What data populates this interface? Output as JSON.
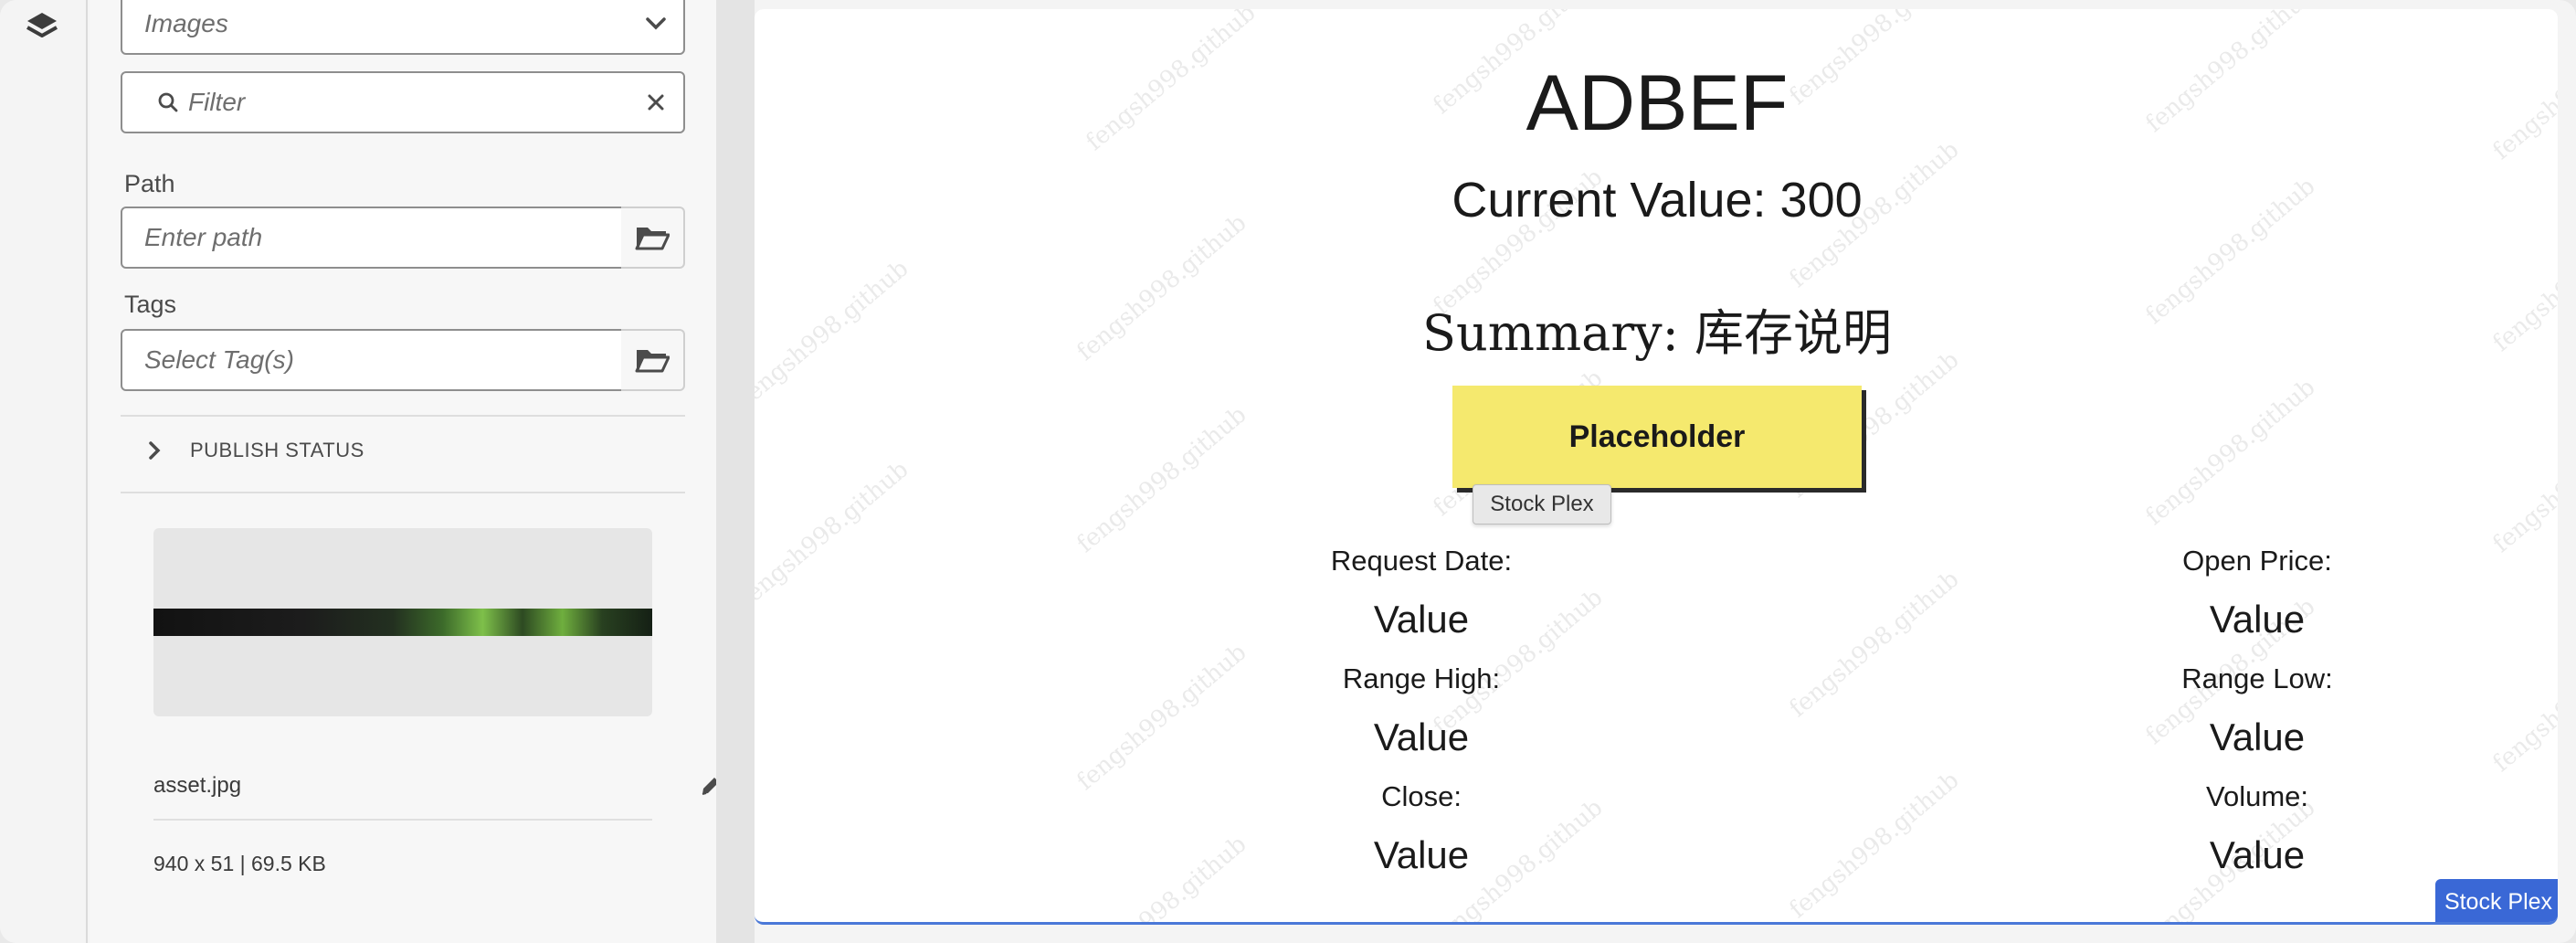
{
  "sidebar": {
    "asset_type": "Images",
    "filter_placeholder": "Filter",
    "path_label": "Path",
    "path_placeholder": "Enter path",
    "tags_label": "Tags",
    "tags_placeholder": "Select Tag(s)",
    "publish_status": "PUBLISH STATUS",
    "asset": {
      "name": "asset.jpg",
      "meta": "940 x 51 | 69.5 KB"
    }
  },
  "canvas": {
    "title": "ADBEF",
    "current_value": "Current Value: 300",
    "summary": "Summary: 库存说明",
    "button_label": "Placeholder",
    "tooltip": "Stock Plex",
    "fields": [
      {
        "label": "Request Date:",
        "value": "Value"
      },
      {
        "label": "Open Price:",
        "value": "Value"
      },
      {
        "label": "Range High:",
        "value": "Value"
      },
      {
        "label": "Range Low:",
        "value": "Value"
      },
      {
        "label": "Close:",
        "value": "Value"
      },
      {
        "label": "Volume:",
        "value": "Value"
      }
    ],
    "badge": "Stock Plex",
    "watermark": "fengsh998.github"
  },
  "icons": {
    "rail": "layers-icon",
    "dropdown": "chevron-down-icon",
    "filter": "search-icon",
    "clear": "close-icon",
    "browse": "folder-icon",
    "expand": "chevron-right-icon",
    "edit": "pencil-icon"
  },
  "colors": {
    "button_bg": "#f5e96e",
    "badge_bg": "#3a68d6",
    "canvas_border": "#4a78d8"
  }
}
